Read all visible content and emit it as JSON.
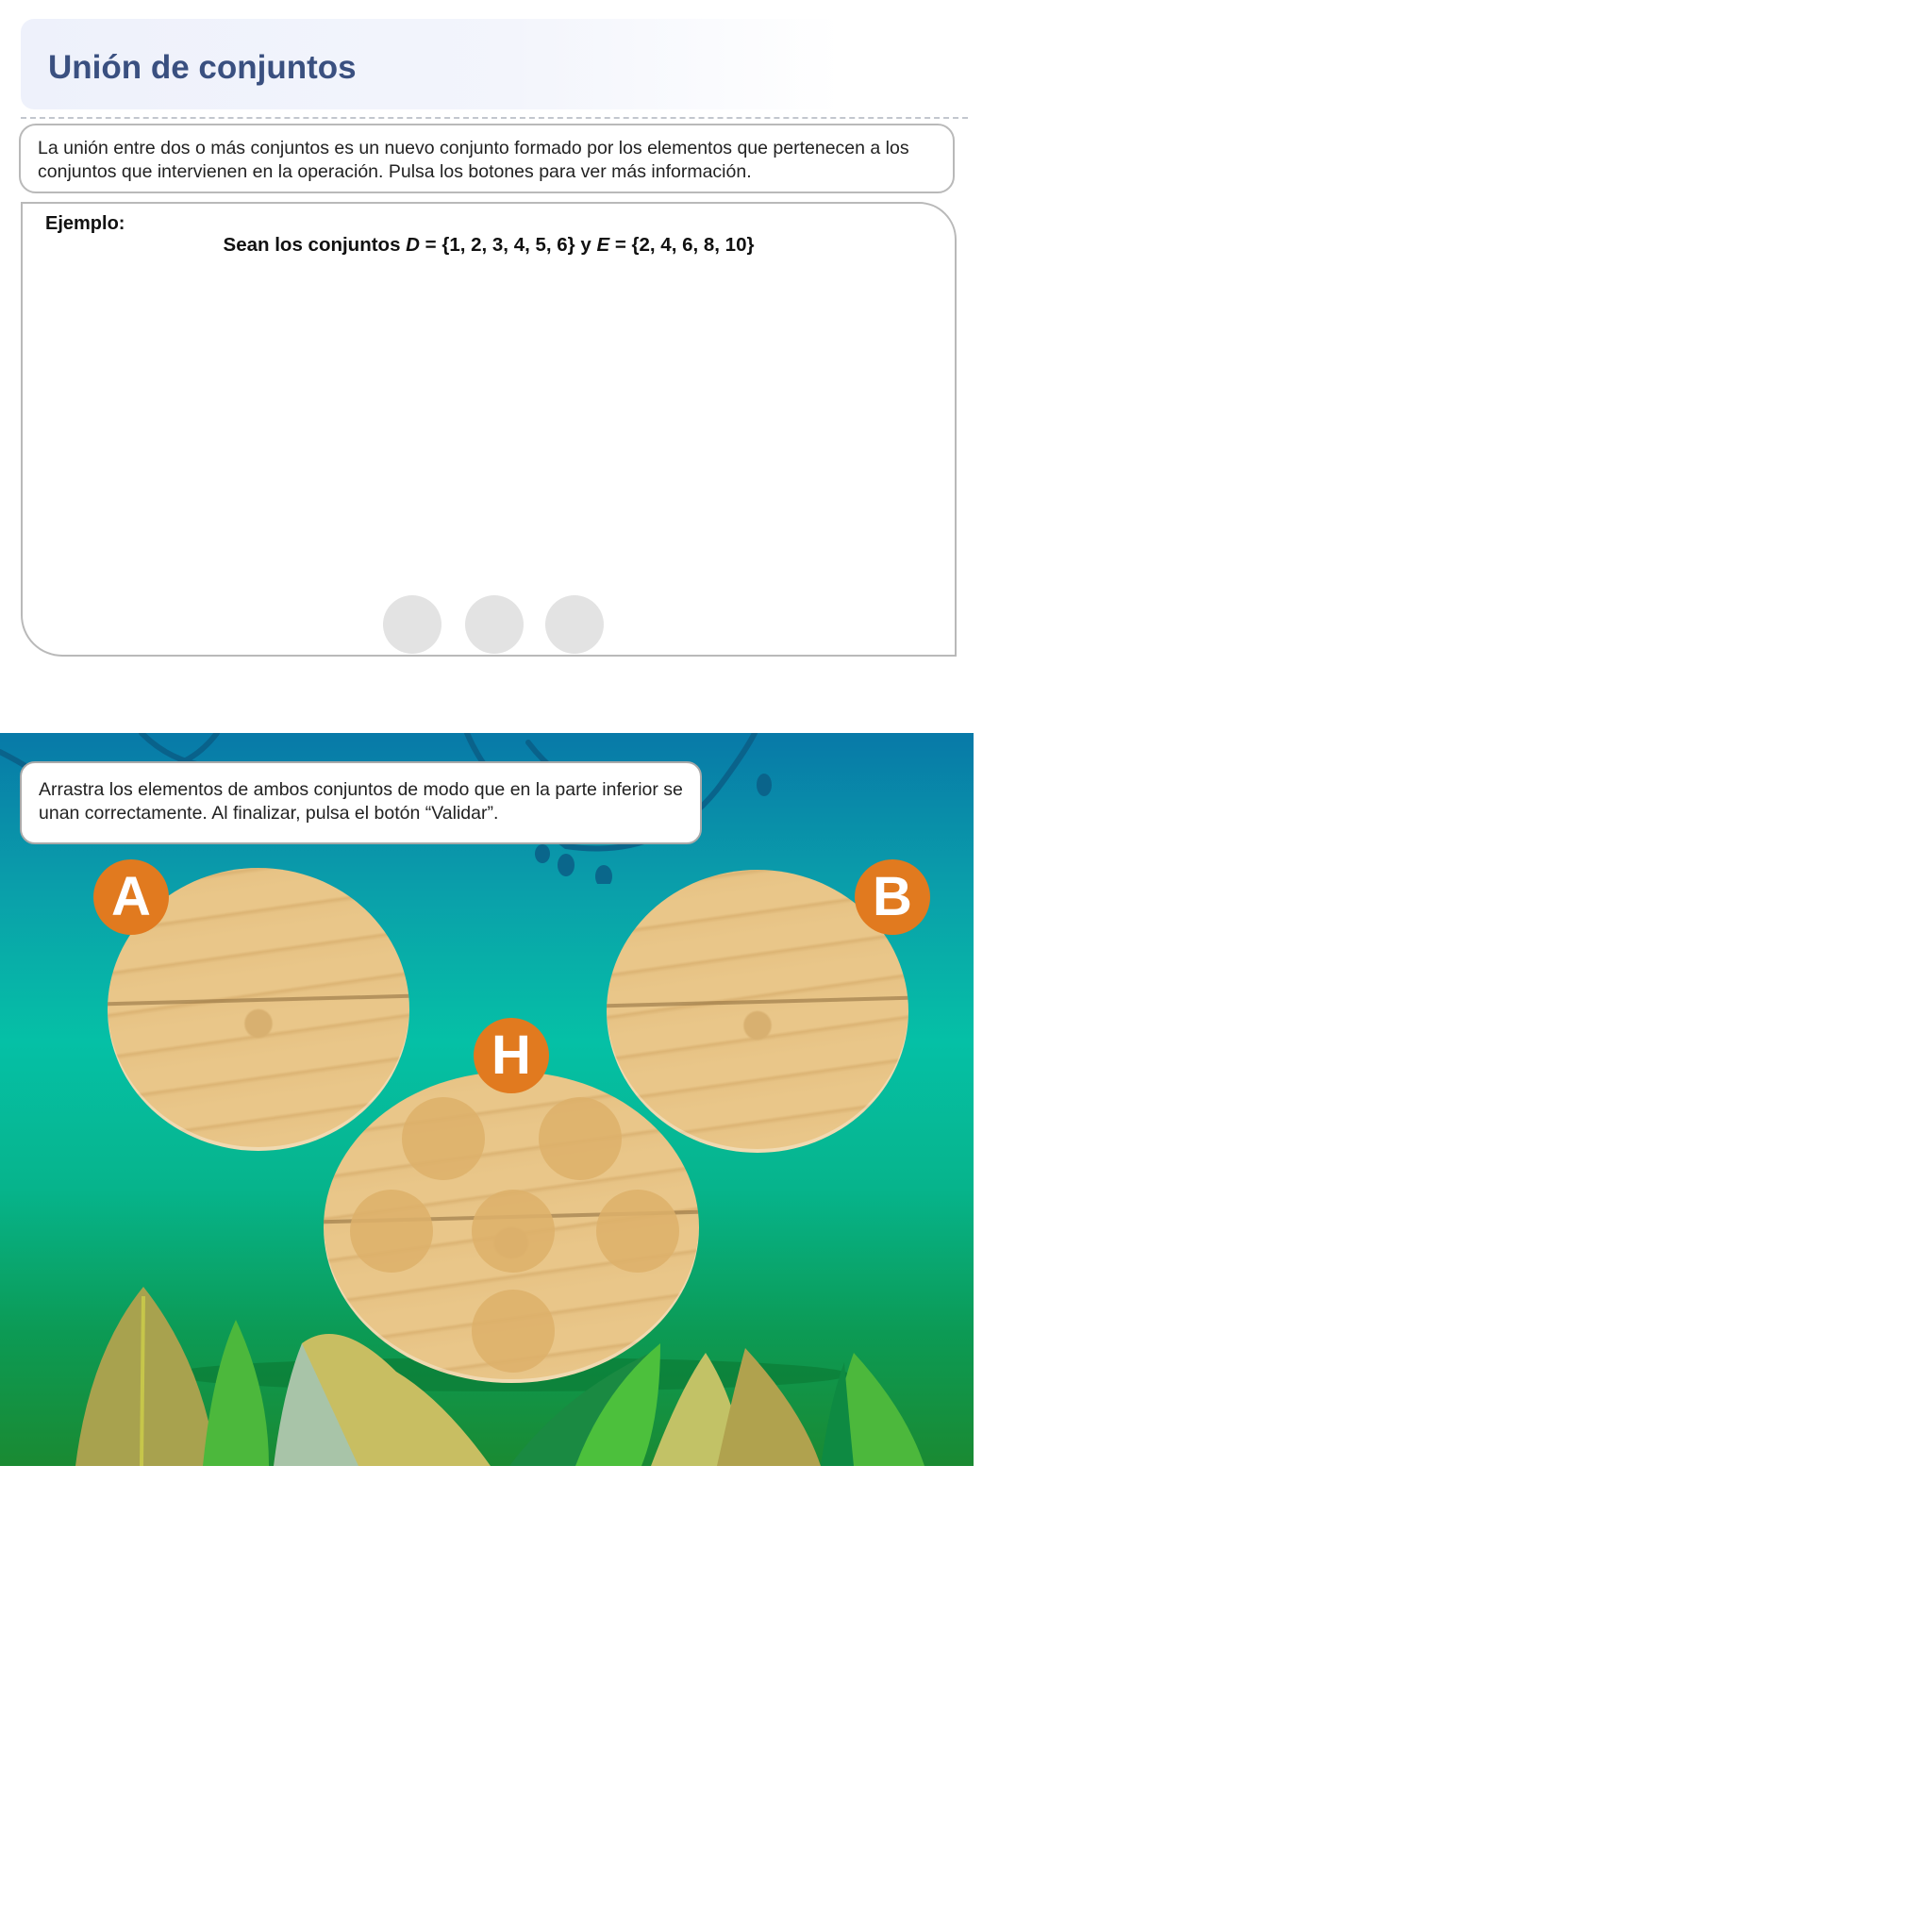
{
  "header": {
    "title": "Unión de conjuntos"
  },
  "intro": {
    "text": "La unión entre dos o más conjuntos es un nuevo conjunto formado por los elementos que pertenecen a los conjuntos que intervienen en la operación. Pulsa los botones para ver más información."
  },
  "example": {
    "label": "Ejemplo:",
    "prefix": "Sean los conjuntos ",
    "set1_name": "D",
    "set1_value": " = {1, 2, 3, 4, 5, 6} y ",
    "set2_name": "E",
    "set2_value": " = {2, 4, 6, 8, 10}",
    "buttons_count": 3
  },
  "activity": {
    "instruction": "Arrastra los elementos de ambos conjuntos de modo que en la parte inferior se unan correctamente. Al finalizar, pulsa el botón “Validar”.",
    "set_a_label": "A",
    "set_b_label": "B",
    "union_label": "H",
    "union_slots": 6,
    "colors": {
      "badge": "#e17a1f",
      "sky_top": "#0879a8",
      "sky_mid": "#05c0a6",
      "ground": "#1a8a32",
      "wood": "#e9c689"
    }
  }
}
